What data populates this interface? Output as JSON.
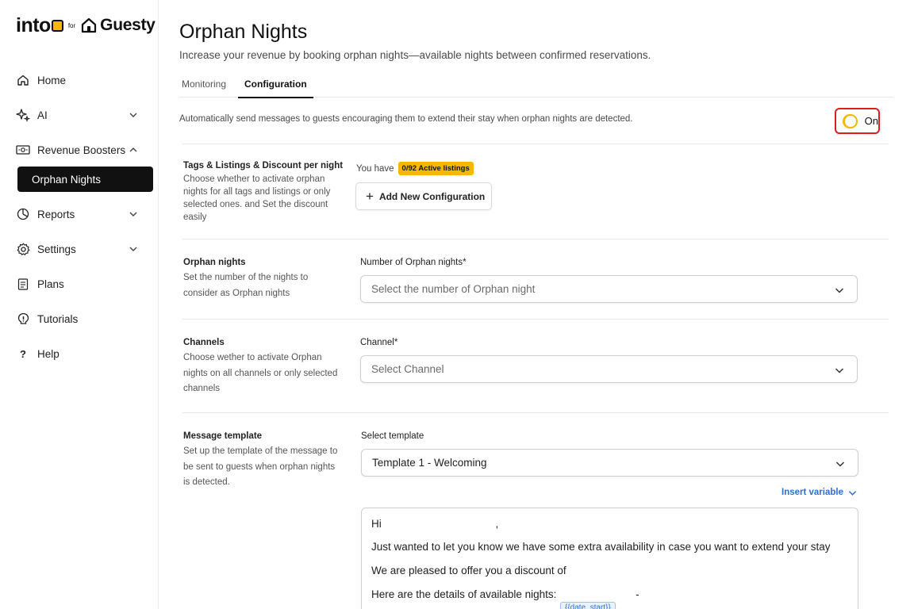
{
  "brand": {
    "name": "into",
    "for": "for",
    "partner": "Guesty"
  },
  "sidebar": {
    "items": [
      {
        "label": "Home",
        "icon": "home-icon"
      },
      {
        "label": "AI",
        "icon": "sparkle-icon",
        "expandable": true,
        "expanded": false
      },
      {
        "label": "Revenue Boosters",
        "icon": "cash-icon",
        "expandable": true,
        "expanded": true
      },
      {
        "label": "Reports",
        "icon": "pie-chart-icon",
        "expandable": true,
        "expanded": false
      },
      {
        "label": "Settings",
        "icon": "gear-icon",
        "expandable": true,
        "expanded": false
      },
      {
        "label": "Plans",
        "icon": "clipboard-icon"
      },
      {
        "label": "Tutorials",
        "icon": "lightbulb-icon"
      },
      {
        "label": "Help",
        "icon": "question-icon"
      }
    ],
    "active_sub": "Orphan Nights"
  },
  "page": {
    "title": "Orphan Nights",
    "subtitle": "Increase your revenue by booking orphan nights—available nights between confirmed reservations."
  },
  "tabs": [
    {
      "label": "Monitoring",
      "active": false
    },
    {
      "label": "Configuration",
      "active": true
    }
  ],
  "auto_send": {
    "text": "Automatically send messages to guests encouraging them to extend their stay when orphan nights are detected.",
    "toggle_label": "On",
    "enabled": true
  },
  "sections": {
    "tags": {
      "title": "Tags & Listings & Discount per night",
      "description": "Choose whether to activate orphan nights for all tags and listings or only selected ones. and Set the discount easily",
      "you_have": "You have",
      "badge": "0/92 Active listings",
      "add_button": "Add New Configuration"
    },
    "orphan_nights": {
      "title": "Orphan nights",
      "description": "Set the number of the nights to consider as Orphan nights",
      "field_label": "Number of Orphan nights*",
      "placeholder": "Select the number of Orphan night"
    },
    "channels": {
      "title": "Channels",
      "description": "Choose wether to activate Orphan nights on all channels or only selected channels",
      "field_label": "Channel*",
      "placeholder": "Select Channel"
    },
    "message": {
      "title": "Message template",
      "description": "Set up the  template of the message to be sent to guests when orphan nights is detected.",
      "field_label": "Select template",
      "selected_template": "Template 1 - Welcoming",
      "insert_variable": "Insert variable",
      "body": {
        "line1": "Hi",
        "line1_punct": ",",
        "line2": "Just wanted to let you know we have some extra availability in case you want to extend your stay",
        "line3": "We are pleased to offer you a discount of",
        "line4": "Here are the details of available nights:",
        "line4_dash": "-",
        "var_chip": "{{date_start}}"
      }
    }
  },
  "colors": {
    "accent": "#f5b800",
    "highlight_border": "#e01b22",
    "link": "#2f6fd1",
    "active_nav_bg": "#111111"
  }
}
